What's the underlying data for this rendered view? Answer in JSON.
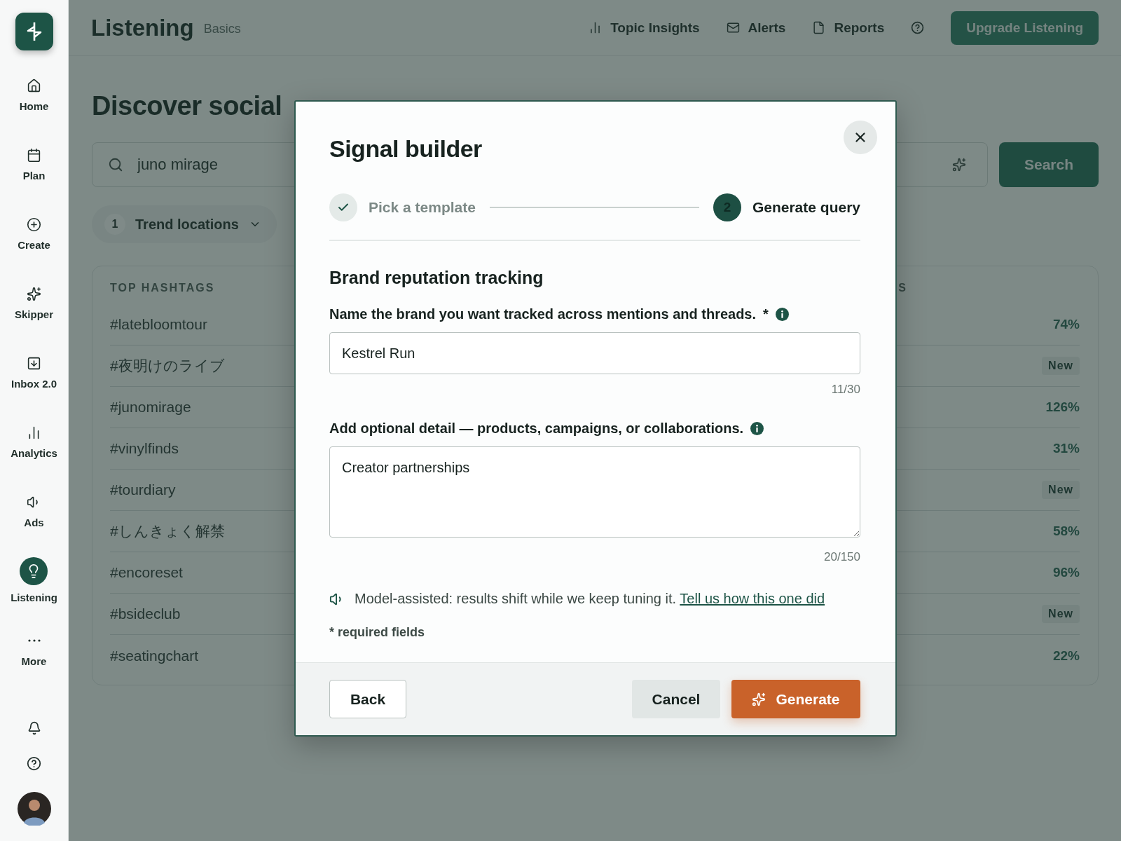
{
  "sidebar": {
    "items": [
      {
        "label": "Home",
        "selected": false
      },
      {
        "label": "Plan",
        "selected": false
      },
      {
        "label": "Create",
        "selected": false
      },
      {
        "label": "Skipper",
        "selected": false
      },
      {
        "label": "Inbox 2.0",
        "selected": false
      },
      {
        "label": "Analytics",
        "selected": false
      },
      {
        "label": "Ads",
        "selected": false
      },
      {
        "label": "Listening",
        "selected": true
      },
      {
        "label": "More",
        "selected": false
      }
    ]
  },
  "topbar": {
    "title": "Listening",
    "plan": "Basics",
    "links": [
      "Topic Insights",
      "Alerts",
      "Reports"
    ],
    "upgrade_button": "Upgrade Listening"
  },
  "page": {
    "heading": "Discover social",
    "search": {
      "value": "juno mirage",
      "button": "Search"
    },
    "filter": {
      "count": "1",
      "label": "Trend locations"
    },
    "card": {
      "column_1": "TOP HASHTAGS",
      "column_2": "S",
      "rows": [
        {
          "tag": "#latebloomtour",
          "kind": "percent",
          "change": "74%"
        },
        {
          "tag": "#夜明けのライブ",
          "kind": "badge",
          "change": "New"
        },
        {
          "tag": "#junomirage",
          "kind": "percent",
          "change": "126%"
        },
        {
          "tag": "#vinylfinds",
          "kind": "percent",
          "change": "31%"
        },
        {
          "tag": "#tourdiary",
          "kind": "badge",
          "change": "New"
        },
        {
          "tag": "#しんきょく解禁",
          "kind": "percent",
          "change": "58%"
        },
        {
          "tag": "#encoreset",
          "kind": "percent",
          "change": "96%"
        },
        {
          "tag": "#bsideclub",
          "kind": "badge",
          "change": "New"
        },
        {
          "tag": "#seatingchart",
          "kind": "percent",
          "change": "22%"
        }
      ]
    }
  },
  "modal": {
    "title": "Signal builder",
    "steps": [
      {
        "label": "Pick a template",
        "completed": true,
        "selected": false
      },
      {
        "label": "Generate query",
        "number": "2",
        "completed": false,
        "selected": true
      }
    ],
    "section_title": "Brand reputation tracking",
    "fields": [
      {
        "kind": "input",
        "label": "Name the brand you want tracked across mentions and threads.",
        "required_mark": "*",
        "value": "Kestrel Run",
        "counter": "11/30"
      },
      {
        "kind": "textarea",
        "label": "Add optional detail — products, campaigns, or collaborations.",
        "value": "Creator partnerships",
        "counter": "20/150"
      }
    ],
    "notice": {
      "text": "Model-assisted: results shift while we keep tuning it.",
      "link": "Tell us how this one did"
    },
    "required_note": "* required fields",
    "buttons": {
      "back": "Back",
      "cancel": "Cancel",
      "generate": "Generate"
    }
  }
}
